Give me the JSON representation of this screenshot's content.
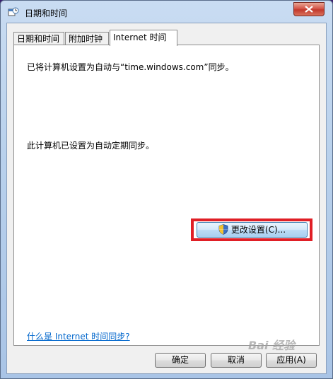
{
  "window": {
    "title": "日期和时间"
  },
  "tabs": [
    {
      "label": "日期和时间",
      "active": false
    },
    {
      "label": "附加时钟",
      "active": false
    },
    {
      "label": "Internet 时间",
      "active": true
    }
  ],
  "internet_time": {
    "sync_message": "已将计算机设置为自动与“time.windows.com”同步。",
    "schedule_message": "此计算机已设置为自动定期同步。",
    "change_settings_label": "更改设置(C)...",
    "help_link": "什么是 Internet 时间同步?"
  },
  "footer": {
    "ok_label": "确定",
    "cancel_label": "取消",
    "apply_label": "应用(A)"
  },
  "watermark": "Bai 经验",
  "colors": {
    "highlight": "#e01f26",
    "link": "#0066cc",
    "close_button": "#c23a2c"
  }
}
